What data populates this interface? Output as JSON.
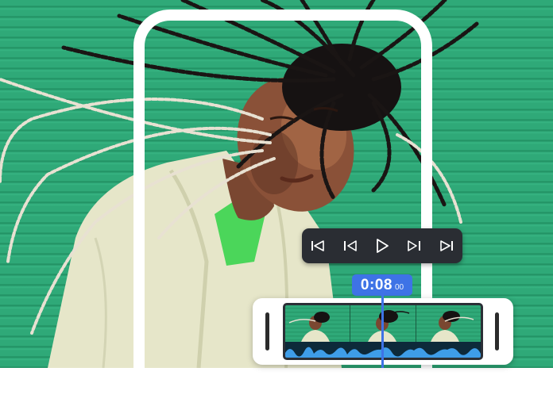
{
  "colors": {
    "background_green": "#2fa978",
    "accent_blue": "#3e73e6",
    "controls_bg": "#2a2d33",
    "frame_white": "#ffffff"
  },
  "player_controls": {
    "buttons": [
      {
        "name": "skip-to-start",
        "icon": "skip-start-icon"
      },
      {
        "name": "step-back",
        "icon": "step-back-icon"
      },
      {
        "name": "play",
        "icon": "play-icon"
      },
      {
        "name": "step-forward",
        "icon": "step-forward-icon"
      },
      {
        "name": "skip-to-end",
        "icon": "skip-end-icon"
      }
    ]
  },
  "timecode": {
    "main": "0:08",
    "frames": "00"
  },
  "timeline": {
    "thumbnail_count": 3,
    "playhead_position": 0.5
  }
}
